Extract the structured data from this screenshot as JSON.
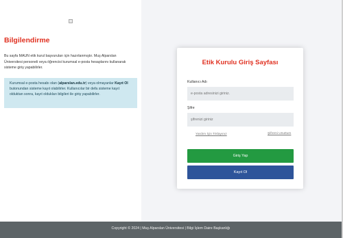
{
  "left": {
    "heading": "Bilgilendirme",
    "intro": "Bu sayfa MAUN etik kurul başvuruları için hazırlanmıştır. Muş Alparslan Üniversitesi personeli veya öğrencisi kurumsal e-posta hesaplarını kullanarak sisteme giriş yapabilirler.",
    "info": {
      "part1": "Kurumsal e-posta hesabı olan (",
      "domain": "alparslan.edu.tr",
      "part2": ") veya olmayanlar",
      "register": "Kayıt Ol",
      "part3": "butonundan sisteme kayıt olabilirler. Kullanıcılar bir defa sisteme kayıt olduktan sonra, kayıt oldukları bilgileri ile giriş yapabilirler."
    }
  },
  "login": {
    "title": "Etik Kurulu Giriş Sayfası",
    "username_label": "Kullanıcı Adı",
    "username_placeholder": "e-posta adresinizi giriniz.",
    "password_label": "Şifre",
    "password_placeholder": "şifrenizi giriniz",
    "help_link": "Yardım İçin Tıklayınız",
    "forgot_link": "Şifremi Unuttum",
    "login_button": "Giriş Yap",
    "register_button": "Kayıt Ol"
  },
  "footer": {
    "text": "Copyright © 2024 | Muş Alparslan Üniversitesi | Bilgi İşlem Daire Başkanlığı"
  },
  "colors": {
    "accent_red": "#e03020",
    "login_green": "#239a41",
    "register_blue": "#2e549a",
    "footer_gray": "#5d6467"
  }
}
